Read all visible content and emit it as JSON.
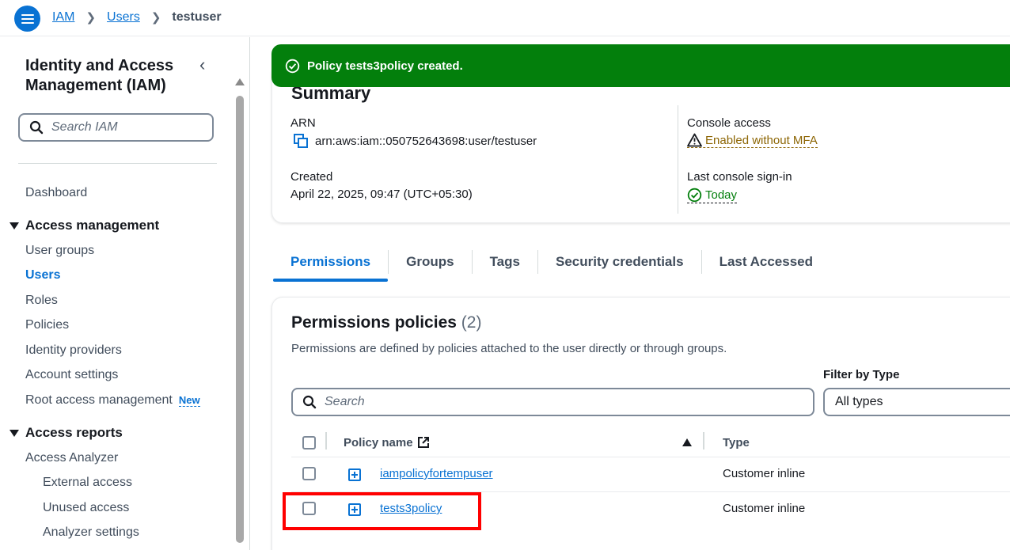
{
  "breadcrumb": {
    "items": [
      "IAM",
      "Users"
    ],
    "current": "testuser"
  },
  "sidebar": {
    "title": "Identity and Access Management (IAM)",
    "search_placeholder": "Search IAM",
    "dashboard": "Dashboard",
    "access_management": {
      "label": "Access management",
      "items": [
        "User groups",
        "Users",
        "Roles",
        "Policies",
        "Identity providers",
        "Account settings",
        "Root access management"
      ],
      "active": "Users",
      "new_badge": "New"
    },
    "access_reports": {
      "label": "Access reports",
      "items": [
        "Access Analyzer"
      ],
      "sub_items": [
        "External access",
        "Unused access",
        "Analyzer settings"
      ]
    }
  },
  "flash": {
    "message": "Policy tests3policy created.",
    "color": "#037f0c"
  },
  "summary": {
    "title": "Summary",
    "arn_label": "ARN",
    "arn_value": "arn:aws:iam::050752643698:user/testuser",
    "created_label": "Created",
    "created_value": "April 22, 2025, 09:47 (UTC+05:30)",
    "console_access_label": "Console access",
    "console_access_value": "Enabled without MFA",
    "last_signin_label": "Last console sign-in",
    "last_signin_value": "Today"
  },
  "tabs": [
    "Permissions",
    "Groups",
    "Tags",
    "Security credentials",
    "Last Accessed"
  ],
  "active_tab": "Permissions",
  "policies": {
    "title": "Permissions policies",
    "count": "(2)",
    "description": "Permissions are defined by policies attached to the user directly or through groups.",
    "filter_label": "Filter by Type",
    "search_placeholder": "Search",
    "filter_value": "All types",
    "columns": {
      "policy_name": "Policy name",
      "type": "Type"
    },
    "rows": [
      {
        "name": "iampolicyfortempuser",
        "type": "Customer inline"
      },
      {
        "name": "tests3policy",
        "type": "Customer inline"
      }
    ]
  },
  "colors": {
    "accent": "#0972d3",
    "success": "#037f0c",
    "warning": "#8d6605",
    "highlight": "#ff0000"
  }
}
